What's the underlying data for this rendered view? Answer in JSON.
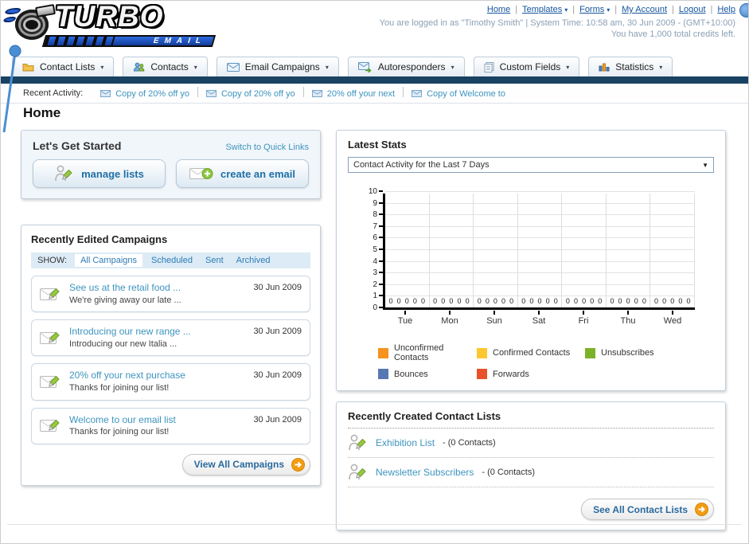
{
  "header": {
    "logo": {
      "title": "TURBO",
      "subtitle": "EMAIL"
    },
    "nav_links": [
      {
        "label": "Home",
        "menu": false
      },
      {
        "label": "Templates",
        "menu": true
      },
      {
        "label": "Forms",
        "menu": true
      },
      {
        "label": "My Account",
        "menu": false
      },
      {
        "label": "Logout",
        "menu": false
      },
      {
        "label": "Help",
        "menu": false
      }
    ],
    "login_line": "You are logged in as \"Timothy Smith\" | System Time: 10:58 am, 30 Jun 2009 - (GMT+10:00)",
    "credits_line": "You have 1,000 total credits left."
  },
  "nav_tabs": [
    {
      "label": "Contact Lists",
      "icon": "folder"
    },
    {
      "label": "Contacts",
      "icon": "people"
    },
    {
      "label": "Email Campaigns",
      "icon": "envelope"
    },
    {
      "label": "Autoresponders",
      "icon": "envelope-arrow"
    },
    {
      "label": "Custom Fields",
      "icon": "pages"
    },
    {
      "label": "Statistics",
      "icon": "bar-chart"
    }
  ],
  "recent_activity": {
    "label": "Recent Activity:",
    "item_icon": "envelope-sm",
    "items": [
      "Copy of 20% off yo",
      "Copy of 20% off yo",
      "20% off your next",
      "Copy of Welcome to"
    ]
  },
  "page_title": "Home",
  "get_started": {
    "title": "Let's Get Started",
    "switch_link": "Switch to Quick Links",
    "buttons": [
      {
        "label": "manage lists",
        "icon": "person-pencil"
      },
      {
        "label": "create an email",
        "icon": "envelope-plus"
      }
    ]
  },
  "campaigns": {
    "title": "Recently Edited Campaigns",
    "show_label": "SHOW:",
    "filters": [
      "All Campaigns",
      "Scheduled",
      "Sent",
      "Archived"
    ],
    "active_filter": "All Campaigns",
    "item_icon": "envelope-pencil",
    "items": [
      {
        "title": "See us at the retail food ...",
        "subtitle": "We're giving away our late ...",
        "date": "30 Jun 2009"
      },
      {
        "title": "Introducing our new range ...",
        "subtitle": "Introducing our new Italia ...",
        "date": "30 Jun 2009"
      },
      {
        "title": "20% off your next purchase",
        "subtitle": "Thanks for joining our list!",
        "date": "30 Jun 2009"
      },
      {
        "title": "Welcome to our email list",
        "subtitle": "Thanks for joining our list!",
        "date": "30 Jun 2009"
      }
    ],
    "view_all_label": "View All Campaigns",
    "arrow_icon": "arrow-circle"
  },
  "stats": {
    "title": "Latest Stats",
    "selected_option": "Contact Activity for the Last 7 Days"
  },
  "chart_data": {
    "type": "bar",
    "title": "Contact Activity for the Last 7 Days",
    "categories": [
      "Tue",
      "Mon",
      "Sun",
      "Sat",
      "Fri",
      "Thu",
      "Wed"
    ],
    "series": [
      {
        "name": "Unconfirmed Contacts",
        "color": "#f6921e",
        "values": [
          0,
          0,
          0,
          0,
          0,
          0,
          0
        ]
      },
      {
        "name": "Confirmed Contacts",
        "color": "#fdc72f",
        "values": [
          0,
          0,
          0,
          0,
          0,
          0,
          0
        ]
      },
      {
        "name": "Unsubscribes",
        "color": "#7cb228",
        "values": [
          0,
          0,
          0,
          0,
          0,
          0,
          0
        ]
      },
      {
        "name": "Bounces",
        "color": "#5878b4",
        "values": [
          0,
          0,
          0,
          0,
          0,
          0,
          0
        ]
      },
      {
        "name": "Forwards",
        "color": "#e85129",
        "values": [
          0,
          0,
          0,
          0,
          0,
          0,
          0
        ]
      }
    ],
    "xlabel": "",
    "ylabel": "",
    "ylim": [
      0,
      10
    ],
    "y_tick_step": 1,
    "grid": true,
    "bar_value_labels": true,
    "legend_position": "bottom"
  },
  "contact_lists": {
    "title": "Recently Created Contact Lists",
    "item_icon": "person-pencil",
    "items": [
      {
        "name": "Exhibition List",
        "detail": "- (0 Contacts)"
      },
      {
        "name": "Newsletter Subscribers",
        "detail": "- (0 Contacts)"
      }
    ],
    "see_all_label": "See All Contact Lists",
    "arrow_icon": "arrow-circle"
  }
}
